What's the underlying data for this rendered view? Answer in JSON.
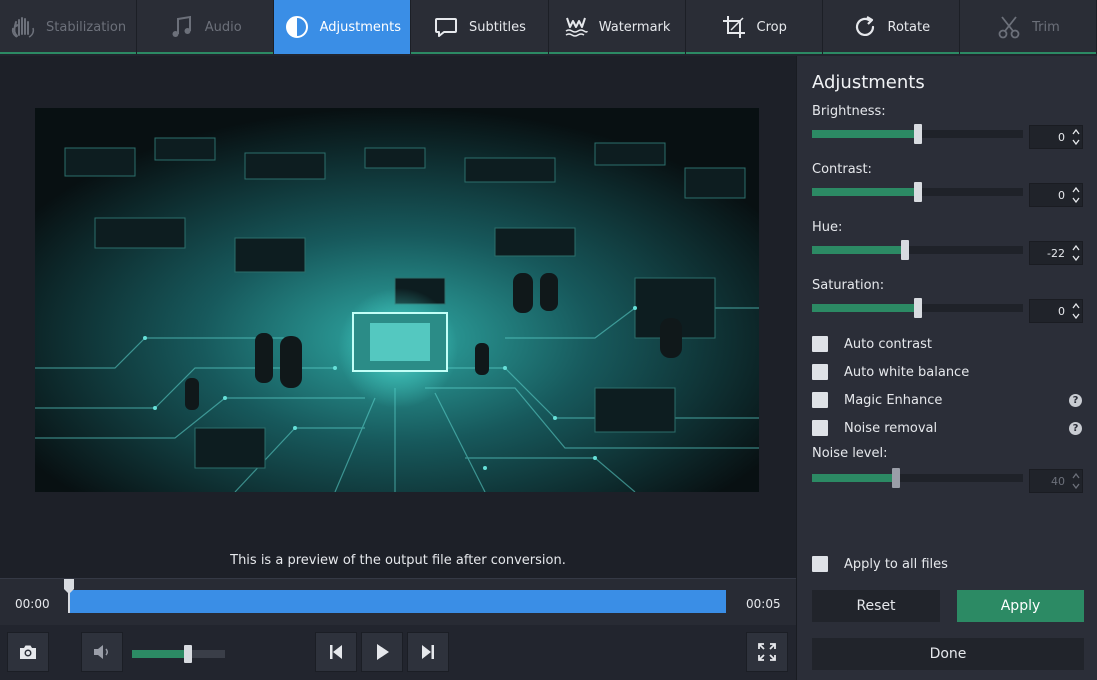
{
  "toolbar": {
    "tabs": [
      {
        "label": "Stabilization",
        "icon": "hand-icon",
        "state": "disabled"
      },
      {
        "label": "Audio",
        "icon": "music-note-icon",
        "state": "disabled"
      },
      {
        "label": "Adjustments",
        "icon": "half-circle-icon",
        "state": "active"
      },
      {
        "label": "Subtitles",
        "icon": "speech-bubble-icon",
        "state": "normal"
      },
      {
        "label": "Watermark",
        "icon": "watermark-icon",
        "state": "normal"
      },
      {
        "label": "Crop",
        "icon": "crop-icon",
        "state": "normal"
      },
      {
        "label": "Rotate",
        "icon": "rotate-icon",
        "state": "normal"
      },
      {
        "label": "Trim",
        "icon": "scissors-icon",
        "state": "disabled"
      }
    ]
  },
  "preview": {
    "caption": "This is a preview of the output file after conversion."
  },
  "timeline": {
    "start": "00:00",
    "end": "00:05",
    "position": 0
  },
  "controls": {
    "volume": 0.6
  },
  "panel": {
    "title": "Adjustments",
    "sliders": [
      {
        "label": "Brightness:",
        "value": "0",
        "fill": 0.5
      },
      {
        "label": "Contrast:",
        "value": "0",
        "fill": 0.5
      },
      {
        "label": "Hue:",
        "value": "-22",
        "fill": 0.44
      },
      {
        "label": "Saturation:",
        "value": "0",
        "fill": 0.5
      }
    ],
    "checkboxes": [
      {
        "label": "Auto contrast",
        "checked": false,
        "help": false
      },
      {
        "label": "Auto white balance",
        "checked": false,
        "help": false
      },
      {
        "label": "Magic Enhance",
        "checked": false,
        "help": true
      },
      {
        "label": "Noise removal",
        "checked": false,
        "help": true
      }
    ],
    "noise": {
      "label": "Noise level:",
      "value": "40",
      "fill": 0.4
    },
    "apply_all": "Apply to all files",
    "help_glyph": "?",
    "reset": "Reset",
    "apply": "Apply",
    "done": "Done"
  },
  "colors": {
    "accent_blue": "#3a8ee6",
    "accent_green": "#2c8a64",
    "panel_bg": "#2b2e38"
  }
}
